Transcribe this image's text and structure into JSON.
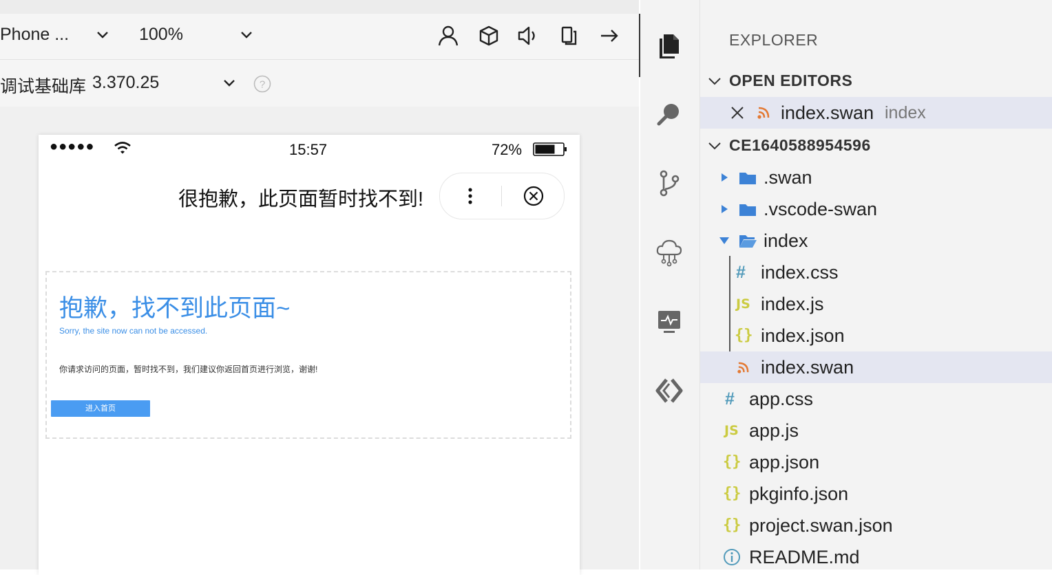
{
  "toolbar": {
    "device": "Phone ...",
    "zoom": "100%",
    "lib_label": "调试基础库",
    "lib_version": "3.370.25",
    "icons": [
      "user-icon",
      "cube-icon",
      "speaker-icon",
      "rotate-icon",
      "arrow-right-icon"
    ]
  },
  "phone": {
    "status": {
      "signal": "●●●●●",
      "time": "15:57",
      "battery": "72%"
    },
    "nav_title": "很抱歉，此页面暂时找不到!",
    "error": {
      "title": "抱歉，找不到此页面~",
      "subtitle": "Sorry, the site now can not be accessed.",
      "description": "你请求访问的页面，暂时找不到，我们建议你返回首页进行浏览，谢谢!",
      "button": "进入首页"
    }
  },
  "activity_bar": [
    "files-icon",
    "search-icon",
    "source-control-icon",
    "cloud-icon",
    "monitor-icon",
    "bracket-logo-icon"
  ],
  "explorer": {
    "title": "EXPLORER",
    "open_editors_label": "OPEN EDITORS",
    "open_editor": {
      "name": "index.swan",
      "folder": "index"
    },
    "project_label": "CE1640588954596",
    "folders": [
      ".swan",
      ".vscode-swan",
      "index"
    ],
    "index_files": [
      "index.css",
      "index.js",
      "index.json",
      "index.swan"
    ],
    "root_files": [
      "app.css",
      "app.js",
      "app.json",
      "pkginfo.json",
      "project.swan.json",
      "README.md"
    ],
    "icon_labels": {
      "css": "#",
      "js": "JS",
      "json": "{}"
    },
    "colors": {
      "folder": "#3c82d6",
      "swan": "#e37933",
      "css": "#519aba",
      "js": "#cbcb41",
      "info": "#519aba",
      "selection": "#e4e6f1"
    }
  }
}
